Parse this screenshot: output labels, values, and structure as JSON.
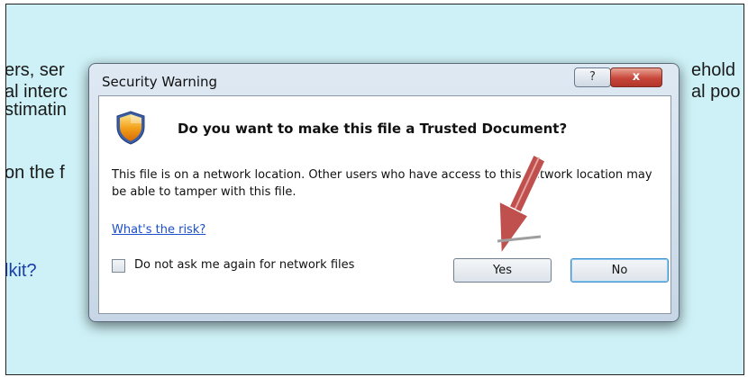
{
  "background": {
    "lines": [
      "ers, ser",
      "al interc",
      "stimatin",
      "on the f",
      "lkit?"
    ],
    "right_lines": [
      "ehold",
      "al poo"
    ]
  },
  "dialog": {
    "title": "Security Warning",
    "help_label": "?",
    "close_label": "x",
    "icon": "shield-warning-icon",
    "question": "Do you want to make this file a Trusted Document?",
    "body": "This file is on a network location. Other users who have access to this network location may be able to tamper with this file.",
    "risk_link": "What's the risk?",
    "checkbox_label": "Do not ask me again for network files",
    "checkbox_checked": false,
    "yes_label": "Yes",
    "no_label": "No"
  },
  "overlay": {
    "arrow": "red-arrow-annotation",
    "arrow_color": "#c0504d"
  }
}
